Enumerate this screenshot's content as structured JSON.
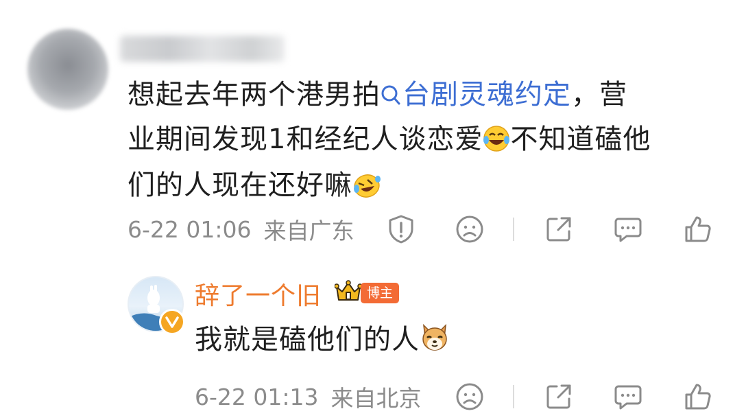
{
  "comment": {
    "text_before": "想起去年两个港男拍",
    "topic_link": "台剧灵魂约定",
    "text_line1_end": "，营",
    "text_line2": "业期间发现1和经纪人谈恋爱",
    "text_line2_end": "不知道磕他",
    "text_line3": "们的人现在还好嘛",
    "time": "6-22 01:06",
    "location": "来自广东",
    "emoji_1": "laughing-tears",
    "emoji_2": "crying-laugh"
  },
  "reply": {
    "author": "辞了一个旧",
    "badge": "博主",
    "text": "我就是磕他们的人",
    "emoji": "dog-face",
    "time": "6-22 01:13",
    "location": "来自北京"
  },
  "colors": {
    "text": "#1f1f1f",
    "meta": "#8b8b8b",
    "link": "#3d6ed3",
    "username": "#ee7b2e",
    "badge_bg": "#f36b35",
    "icon": "#8b8b8b"
  },
  "icons": [
    "search-icon",
    "report-icon",
    "dislike-icon",
    "share-icon",
    "reply-icon",
    "like-icon",
    "crown-icon",
    "verified-icon"
  ]
}
